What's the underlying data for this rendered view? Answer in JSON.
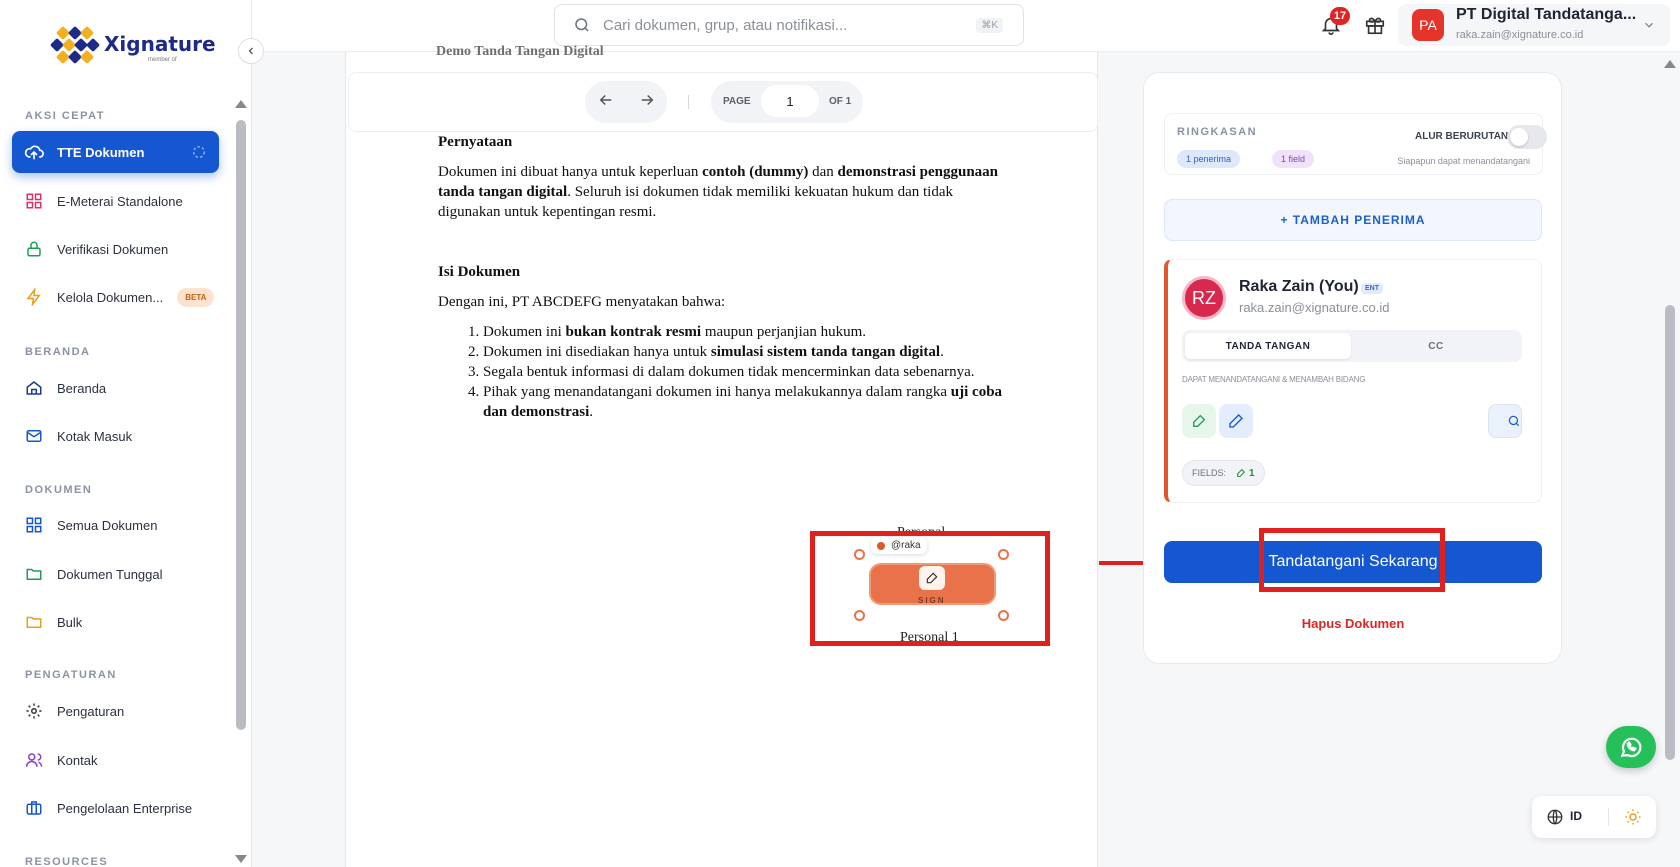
{
  "brand": {
    "name": "Xignature",
    "sub": "member of"
  },
  "search": {
    "placeholder": "Cari dokumen, grup, atau notifikasi...",
    "shortcut": "⌘K"
  },
  "notifications": {
    "count": "17"
  },
  "profile": {
    "initials": "PA",
    "name": "PT Digital Tandatanga...",
    "email": "raka.zain@xignature.co.id"
  },
  "sidebar": {
    "sections": {
      "quick": "AKSI CEPAT",
      "home": "BERANDA",
      "docs": "DOKUMEN",
      "settings": "PENGATURAN",
      "resources": "RESOURCES"
    },
    "items": [
      {
        "label": "TTE Dokumen",
        "icon": "upload-cloud-icon",
        "active": true
      },
      {
        "label": "E-Meterai Standalone",
        "icon": "grid-icon"
      },
      {
        "label": "Verifikasi Dokumen",
        "icon": "lock-icon"
      },
      {
        "label": "Kelola Dokumen...",
        "icon": "bolt-icon",
        "badge": "BETA"
      },
      {
        "label": "Beranda",
        "icon": "home-icon"
      },
      {
        "label": "Kotak Masuk",
        "icon": "mail-icon"
      },
      {
        "label": "Semua Dokumen",
        "icon": "grid-icon"
      },
      {
        "label": "Dokumen Tunggal",
        "icon": "folder-icon"
      },
      {
        "label": "Bulk",
        "icon": "folder-icon"
      },
      {
        "label": "Pengaturan",
        "icon": "gear-icon"
      },
      {
        "label": "Kontak",
        "icon": "users-icon"
      },
      {
        "label": "Pengelolaan Enterprise",
        "icon": "briefcase-icon"
      }
    ]
  },
  "viewer": {
    "page_label": "PAGE",
    "page": "1",
    "of_label": "OF 1",
    "ghost_heading": "Demo Tanda Tangan Digital"
  },
  "document": {
    "h1": "Pernyataan",
    "p1_parts": [
      "Dokumen ini dibuat hanya untuk keperluan ",
      "contoh (dummy)",
      " dan ",
      "demonstrasi penggunaan tanda tangan digital",
      ". Seluruh isi dokumen tidak memiliki kekuatan hukum dan tidak digunakan untuk kepentingan resmi."
    ],
    "h2": "Isi Dokumen",
    "p2": "Dengan ini, PT ABCDEFG menyatakan bahwa:",
    "li1": [
      "Dokumen ini ",
      "bukan kontrak resmi",
      " maupun perjanjian hukum."
    ],
    "li2": [
      "Dokumen ini disediakan hanya untuk ",
      "simulasi sistem tanda tangan digital",
      "."
    ],
    "li3": "Segala bentuk informasi di dalam dokumen tidak mencerminkan data sebenarnya.",
    "li4": [
      "Pihak yang menandatangani dokumen ini hanya melakukannya dalam rangka ",
      "uji coba dan demonstrasi",
      "."
    ]
  },
  "signature_field": {
    "tag": "@raka",
    "label": "SIGN",
    "above": "Personal",
    "below": "Personal 1"
  },
  "panel": {
    "summary_label": "RINGKASAN",
    "chip_recipients": "1 penerima",
    "chip_fields": "1 field",
    "sequential_label": "ALUR BERURUTAN",
    "sequential_hint": "Siapapun dapat menandatangani",
    "add_recipient": "+ TAMBAH PENERIMA",
    "recipient": {
      "initials": "RZ",
      "name": "Raka Zain (You)",
      "badge": "ENT",
      "email": "raka.zain@xignature.co.id",
      "tab_sign": "TANDA TANGAN",
      "tab_cc": "CC",
      "hint": "DAPAT MENANDATANGANI & MENAMBAH BIDANG",
      "fields_label": "FIELDS:",
      "fields_count": "1"
    },
    "sign_now": "Tandatangani Sekarang",
    "delete": "Hapus Dokumen"
  },
  "footer": {
    "lang": "ID"
  },
  "colors": {
    "primary": "#1557d0",
    "danger": "#e02424",
    "accent_orange": "#e8734a"
  }
}
